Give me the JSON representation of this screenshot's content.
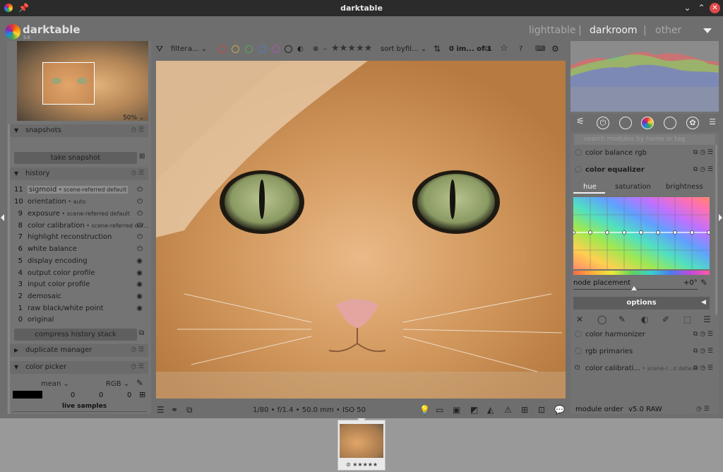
{
  "titlebar": {
    "title": "darktable"
  },
  "app": {
    "name": "darktable",
    "version": "5.0"
  },
  "views": {
    "lighttable": "lighttable",
    "darkroom": "darkroom",
    "other": "other",
    "separator": "|"
  },
  "navigation": {
    "zoom": "50%"
  },
  "left_panel": {
    "snapshots": {
      "title": "snapshots",
      "take_snapshot": "take snapshot"
    },
    "history": {
      "title": "history",
      "items": [
        {
          "num": "11",
          "label": "sigmoid",
          "sub": " • scene-referred default"
        },
        {
          "num": "10",
          "label": "orientation",
          "sub": " • auto"
        },
        {
          "num": "9",
          "label": "exposure",
          "sub": " • scene-referred default"
        },
        {
          "num": "8",
          "label": "color calibration",
          "sub": " • scene-referred def…"
        },
        {
          "num": "7",
          "label": "highlight reconstruction",
          "sub": ""
        },
        {
          "num": "6",
          "label": "white balance",
          "sub": ""
        },
        {
          "num": "5",
          "label": "display encoding",
          "sub": ""
        },
        {
          "num": "4",
          "label": "output color profile",
          "sub": ""
        },
        {
          "num": "3",
          "label": "input color profile",
          "sub": ""
        },
        {
          "num": "2",
          "label": "demosaic",
          "sub": ""
        },
        {
          "num": "1",
          "label": "raw black/white point",
          "sub": ""
        },
        {
          "num": "0",
          "label": "original",
          "sub": ""
        }
      ],
      "compress": "compress history stack"
    },
    "duplicate_manager": {
      "title": "duplicate manager"
    },
    "color_picker": {
      "title": "color picker",
      "mode": "mean",
      "space": "RGB",
      "values": [
        "0",
        "0",
        "0"
      ],
      "live_samples": "live samples"
    }
  },
  "top_toolbar": {
    "filter_label": "filter",
    "filter_value": "a...",
    "sort_label": "sort by",
    "sort_value": "fil...",
    "count": "0 im... of 1",
    "rating_stars": "★★★★★"
  },
  "bottom_bar": {
    "exif": "1/80 • f/1.4 • 50.0 mm • ISO 50"
  },
  "right_panel": {
    "search_placeholder": "search modules by name or tag",
    "modules_top": [
      "color balance rgb",
      "color equalizer"
    ],
    "color_equalizer": {
      "tabs": [
        "hue",
        "saturation",
        "brightness"
      ],
      "node_placement_label": "node placement",
      "node_placement_value": "+0°",
      "options": "options"
    },
    "modules_bottom": [
      {
        "label": "color harmonizer",
        "sub": ""
      },
      {
        "label": "rgb primaries",
        "sub": ""
      },
      {
        "label": "color calibrati...",
        "sub": " • scene-r...d default"
      }
    ],
    "module_order_label": "module order",
    "module_order_value": "v5.0 RAW"
  },
  "filmstrip": {
    "stars": "⊘ ★★★★★"
  }
}
